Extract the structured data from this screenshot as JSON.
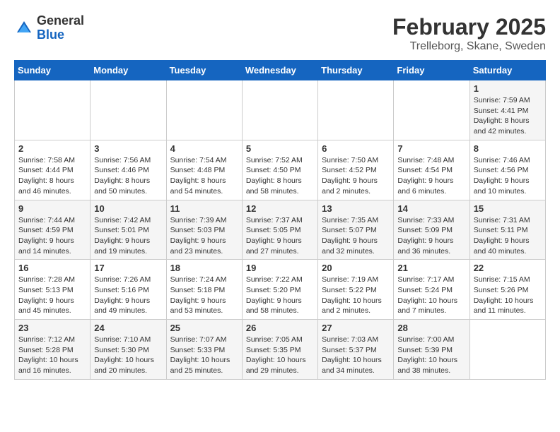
{
  "header": {
    "logo_general": "General",
    "logo_blue": "Blue",
    "month_year": "February 2025",
    "location": "Trelleborg, Skane, Sweden"
  },
  "weekdays": [
    "Sunday",
    "Monday",
    "Tuesday",
    "Wednesday",
    "Thursday",
    "Friday",
    "Saturday"
  ],
  "weeks": [
    [
      {
        "day": "",
        "info": ""
      },
      {
        "day": "",
        "info": ""
      },
      {
        "day": "",
        "info": ""
      },
      {
        "day": "",
        "info": ""
      },
      {
        "day": "",
        "info": ""
      },
      {
        "day": "",
        "info": ""
      },
      {
        "day": "1",
        "info": "Sunrise: 7:59 AM\nSunset: 4:41 PM\nDaylight: 8 hours and 42 minutes."
      }
    ],
    [
      {
        "day": "2",
        "info": "Sunrise: 7:58 AM\nSunset: 4:44 PM\nDaylight: 8 hours and 46 minutes."
      },
      {
        "day": "3",
        "info": "Sunrise: 7:56 AM\nSunset: 4:46 PM\nDaylight: 8 hours and 50 minutes."
      },
      {
        "day": "4",
        "info": "Sunrise: 7:54 AM\nSunset: 4:48 PM\nDaylight: 8 hours and 54 minutes."
      },
      {
        "day": "5",
        "info": "Sunrise: 7:52 AM\nSunset: 4:50 PM\nDaylight: 8 hours and 58 minutes."
      },
      {
        "day": "6",
        "info": "Sunrise: 7:50 AM\nSunset: 4:52 PM\nDaylight: 9 hours and 2 minutes."
      },
      {
        "day": "7",
        "info": "Sunrise: 7:48 AM\nSunset: 4:54 PM\nDaylight: 9 hours and 6 minutes."
      },
      {
        "day": "8",
        "info": "Sunrise: 7:46 AM\nSunset: 4:56 PM\nDaylight: 9 hours and 10 minutes."
      }
    ],
    [
      {
        "day": "9",
        "info": "Sunrise: 7:44 AM\nSunset: 4:59 PM\nDaylight: 9 hours and 14 minutes."
      },
      {
        "day": "10",
        "info": "Sunrise: 7:42 AM\nSunset: 5:01 PM\nDaylight: 9 hours and 19 minutes."
      },
      {
        "day": "11",
        "info": "Sunrise: 7:39 AM\nSunset: 5:03 PM\nDaylight: 9 hours and 23 minutes."
      },
      {
        "day": "12",
        "info": "Sunrise: 7:37 AM\nSunset: 5:05 PM\nDaylight: 9 hours and 27 minutes."
      },
      {
        "day": "13",
        "info": "Sunrise: 7:35 AM\nSunset: 5:07 PM\nDaylight: 9 hours and 32 minutes."
      },
      {
        "day": "14",
        "info": "Sunrise: 7:33 AM\nSunset: 5:09 PM\nDaylight: 9 hours and 36 minutes."
      },
      {
        "day": "15",
        "info": "Sunrise: 7:31 AM\nSunset: 5:11 PM\nDaylight: 9 hours and 40 minutes."
      }
    ],
    [
      {
        "day": "16",
        "info": "Sunrise: 7:28 AM\nSunset: 5:13 PM\nDaylight: 9 hours and 45 minutes."
      },
      {
        "day": "17",
        "info": "Sunrise: 7:26 AM\nSunset: 5:16 PM\nDaylight: 9 hours and 49 minutes."
      },
      {
        "day": "18",
        "info": "Sunrise: 7:24 AM\nSunset: 5:18 PM\nDaylight: 9 hours and 53 minutes."
      },
      {
        "day": "19",
        "info": "Sunrise: 7:22 AM\nSunset: 5:20 PM\nDaylight: 9 hours and 58 minutes."
      },
      {
        "day": "20",
        "info": "Sunrise: 7:19 AM\nSunset: 5:22 PM\nDaylight: 10 hours and 2 minutes."
      },
      {
        "day": "21",
        "info": "Sunrise: 7:17 AM\nSunset: 5:24 PM\nDaylight: 10 hours and 7 minutes."
      },
      {
        "day": "22",
        "info": "Sunrise: 7:15 AM\nSunset: 5:26 PM\nDaylight: 10 hours and 11 minutes."
      }
    ],
    [
      {
        "day": "23",
        "info": "Sunrise: 7:12 AM\nSunset: 5:28 PM\nDaylight: 10 hours and 16 minutes."
      },
      {
        "day": "24",
        "info": "Sunrise: 7:10 AM\nSunset: 5:30 PM\nDaylight: 10 hours and 20 minutes."
      },
      {
        "day": "25",
        "info": "Sunrise: 7:07 AM\nSunset: 5:33 PM\nDaylight: 10 hours and 25 minutes."
      },
      {
        "day": "26",
        "info": "Sunrise: 7:05 AM\nSunset: 5:35 PM\nDaylight: 10 hours and 29 minutes."
      },
      {
        "day": "27",
        "info": "Sunrise: 7:03 AM\nSunset: 5:37 PM\nDaylight: 10 hours and 34 minutes."
      },
      {
        "day": "28",
        "info": "Sunrise: 7:00 AM\nSunset: 5:39 PM\nDaylight: 10 hours and 38 minutes."
      },
      {
        "day": "",
        "info": ""
      }
    ]
  ]
}
